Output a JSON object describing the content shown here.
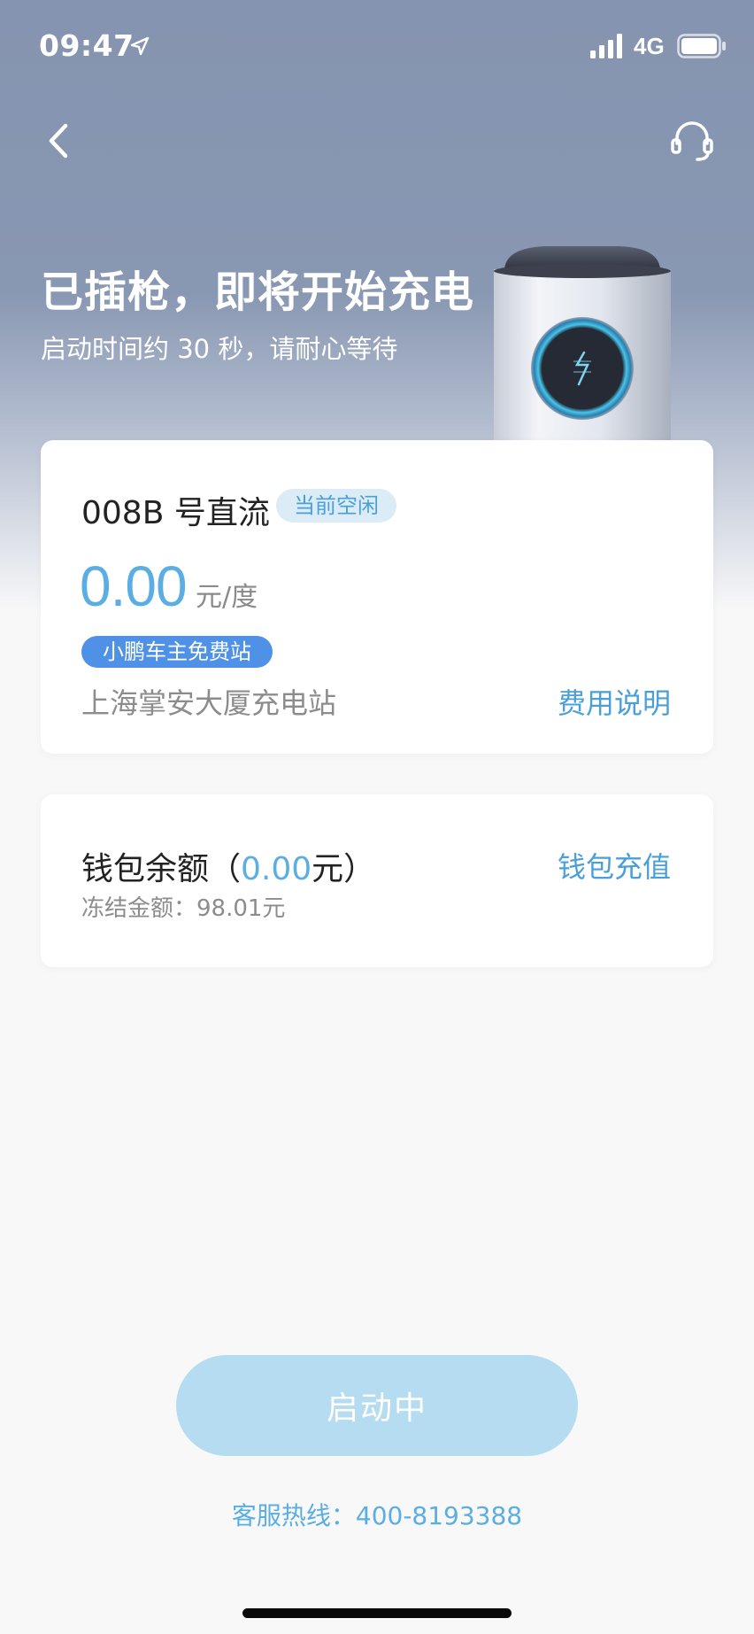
{
  "status_bar": {
    "time": "09:47",
    "network": "4G",
    "icons": [
      "location-arrow-icon",
      "signal-icon",
      "battery-icon"
    ]
  },
  "nav": {
    "icons": [
      "back-chevron-icon",
      "headset-support-icon"
    ]
  },
  "hero": {
    "title": "已插枪，即将开始充电",
    "subtitle": "启动时间约 30 秒，请耐心等待"
  },
  "station_card": {
    "pile_name": "008B 号直流",
    "pile_status": "当前空闲",
    "price_value": "0.00",
    "price_unit": "元/度",
    "free_badge": "小鹏车主免费站",
    "station_name": "上海掌安大厦充电站",
    "fee_link": "费用说明"
  },
  "wallet_card": {
    "title_prefix": "钱包余额（",
    "balance": "0.00",
    "title_suffix": "元）",
    "frozen": "冻结金额：98.01元",
    "topup_link": "钱包充值"
  },
  "footer": {
    "start_button": "启动中",
    "hotline": "客服热线：400-8193388"
  },
  "colors": {
    "accent": "#5aaee3",
    "link": "#4a9fd6",
    "badge_blue": "#4f91e6",
    "button_disabled": "#b6dcf1",
    "hero_top": "#8594b0"
  }
}
